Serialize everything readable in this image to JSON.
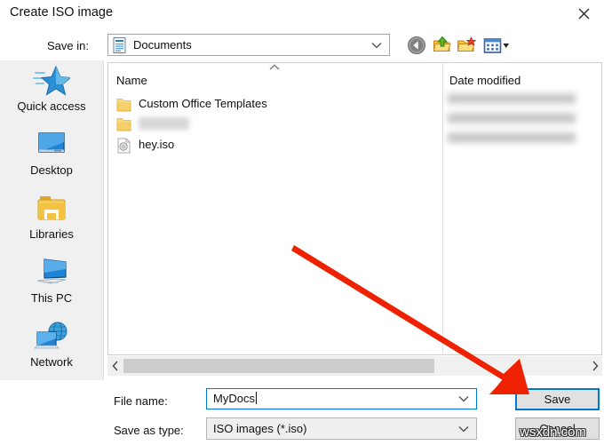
{
  "window": {
    "title": "Create ISO image",
    "close_icon": "close-icon"
  },
  "toolbar": {
    "save_in_label": "Save in:",
    "location": {
      "value": "Documents",
      "icon": "documents-folder-icon",
      "chevron_icon": "chevron-down-icon"
    },
    "buttons": [
      {
        "name": "back-button",
        "icon": "back-arrow-icon",
        "tooltip": "Back"
      },
      {
        "name": "up-one-level-button",
        "icon": "folder-up-arrow-icon",
        "tooltip": "Up one level"
      },
      {
        "name": "new-folder-button",
        "icon": "new-folder-icon",
        "tooltip": "Create New Folder"
      },
      {
        "name": "views-button",
        "icon": "views-grid-icon",
        "tooltip": "Views"
      }
    ]
  },
  "places": {
    "items": [
      {
        "label": "Quick access",
        "icon": "quick-access-star-icon"
      },
      {
        "label": "Desktop",
        "icon": "desktop-monitor-icon"
      },
      {
        "label": "Libraries",
        "icon": "libraries-folder-icon"
      },
      {
        "label": "This PC",
        "icon": "this-pc-icon"
      },
      {
        "label": "Network",
        "icon": "network-globe-icon"
      }
    ]
  },
  "file_list": {
    "columns": [
      {
        "label": "Name",
        "sort_icon": "sort-ascending-icon"
      },
      {
        "label": "Date modified"
      }
    ],
    "rows": [
      {
        "name": "Custom Office Templates",
        "icon": "folder-icon",
        "redacted": false
      },
      {
        "name": "",
        "icon": "folder-icon",
        "redacted": true
      },
      {
        "name": "hey.iso",
        "icon": "iso-disc-file-icon",
        "redacted": false
      }
    ],
    "dates_redacted": true,
    "scrollbar": {
      "left_icon": "chevron-left-icon",
      "right_icon": "chevron-right-icon"
    }
  },
  "form": {
    "file_name_label": "File name:",
    "file_name_value": "MyDocs",
    "file_name_placeholder": "",
    "save_as_type_label": "Save as type:",
    "save_as_type_value": "ISO images (*.iso)",
    "chevron_icon": "chevron-down-icon"
  },
  "actions": {
    "save_label": "Save",
    "cancel_label": "Cancel"
  },
  "annotation": {
    "arrow_color": "#ee2200",
    "points_to": "save-button"
  },
  "watermark": {
    "text": "wsxdn.com"
  }
}
